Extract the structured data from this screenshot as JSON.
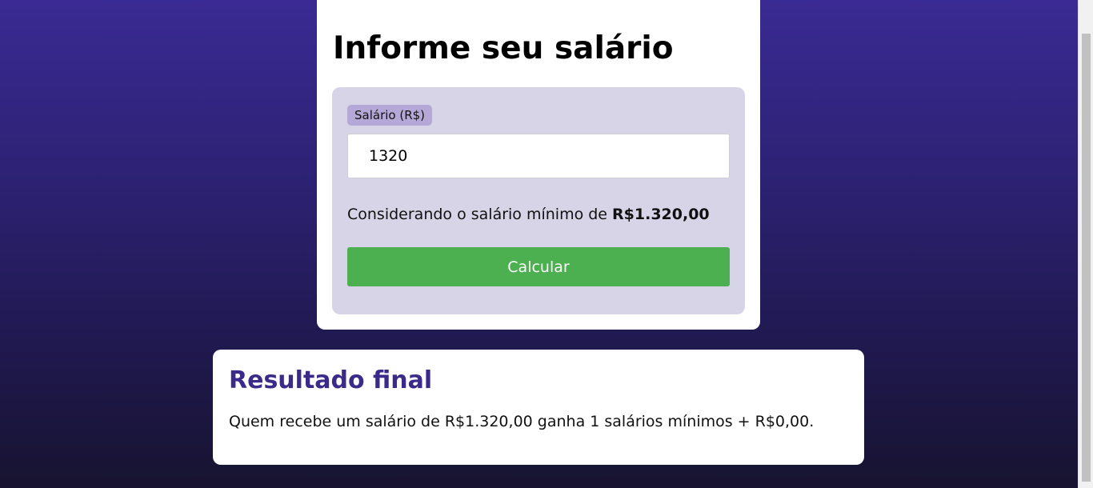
{
  "form": {
    "title": "Informe seu salário",
    "salary_label": "Salário (R$)",
    "salary_value": "1320",
    "min_wage_prefix": "Considerando o salário mínimo de ",
    "min_wage_value": "R$1.320,00",
    "calculate_label": "Calcular",
    "button_color": "#4caf50"
  },
  "result": {
    "title": "Resultado final",
    "text": "Quem recebe um salário de R$1.320,00 ganha 1 salários mínimos + R$0,00."
  },
  "theme": {
    "background_top": "#3a2a93",
    "background_bottom": "#171330",
    "result_title_color": "#3b2a8a",
    "label_badge_color": "#b4a9d6",
    "panel_color": "#d8d4e8"
  }
}
